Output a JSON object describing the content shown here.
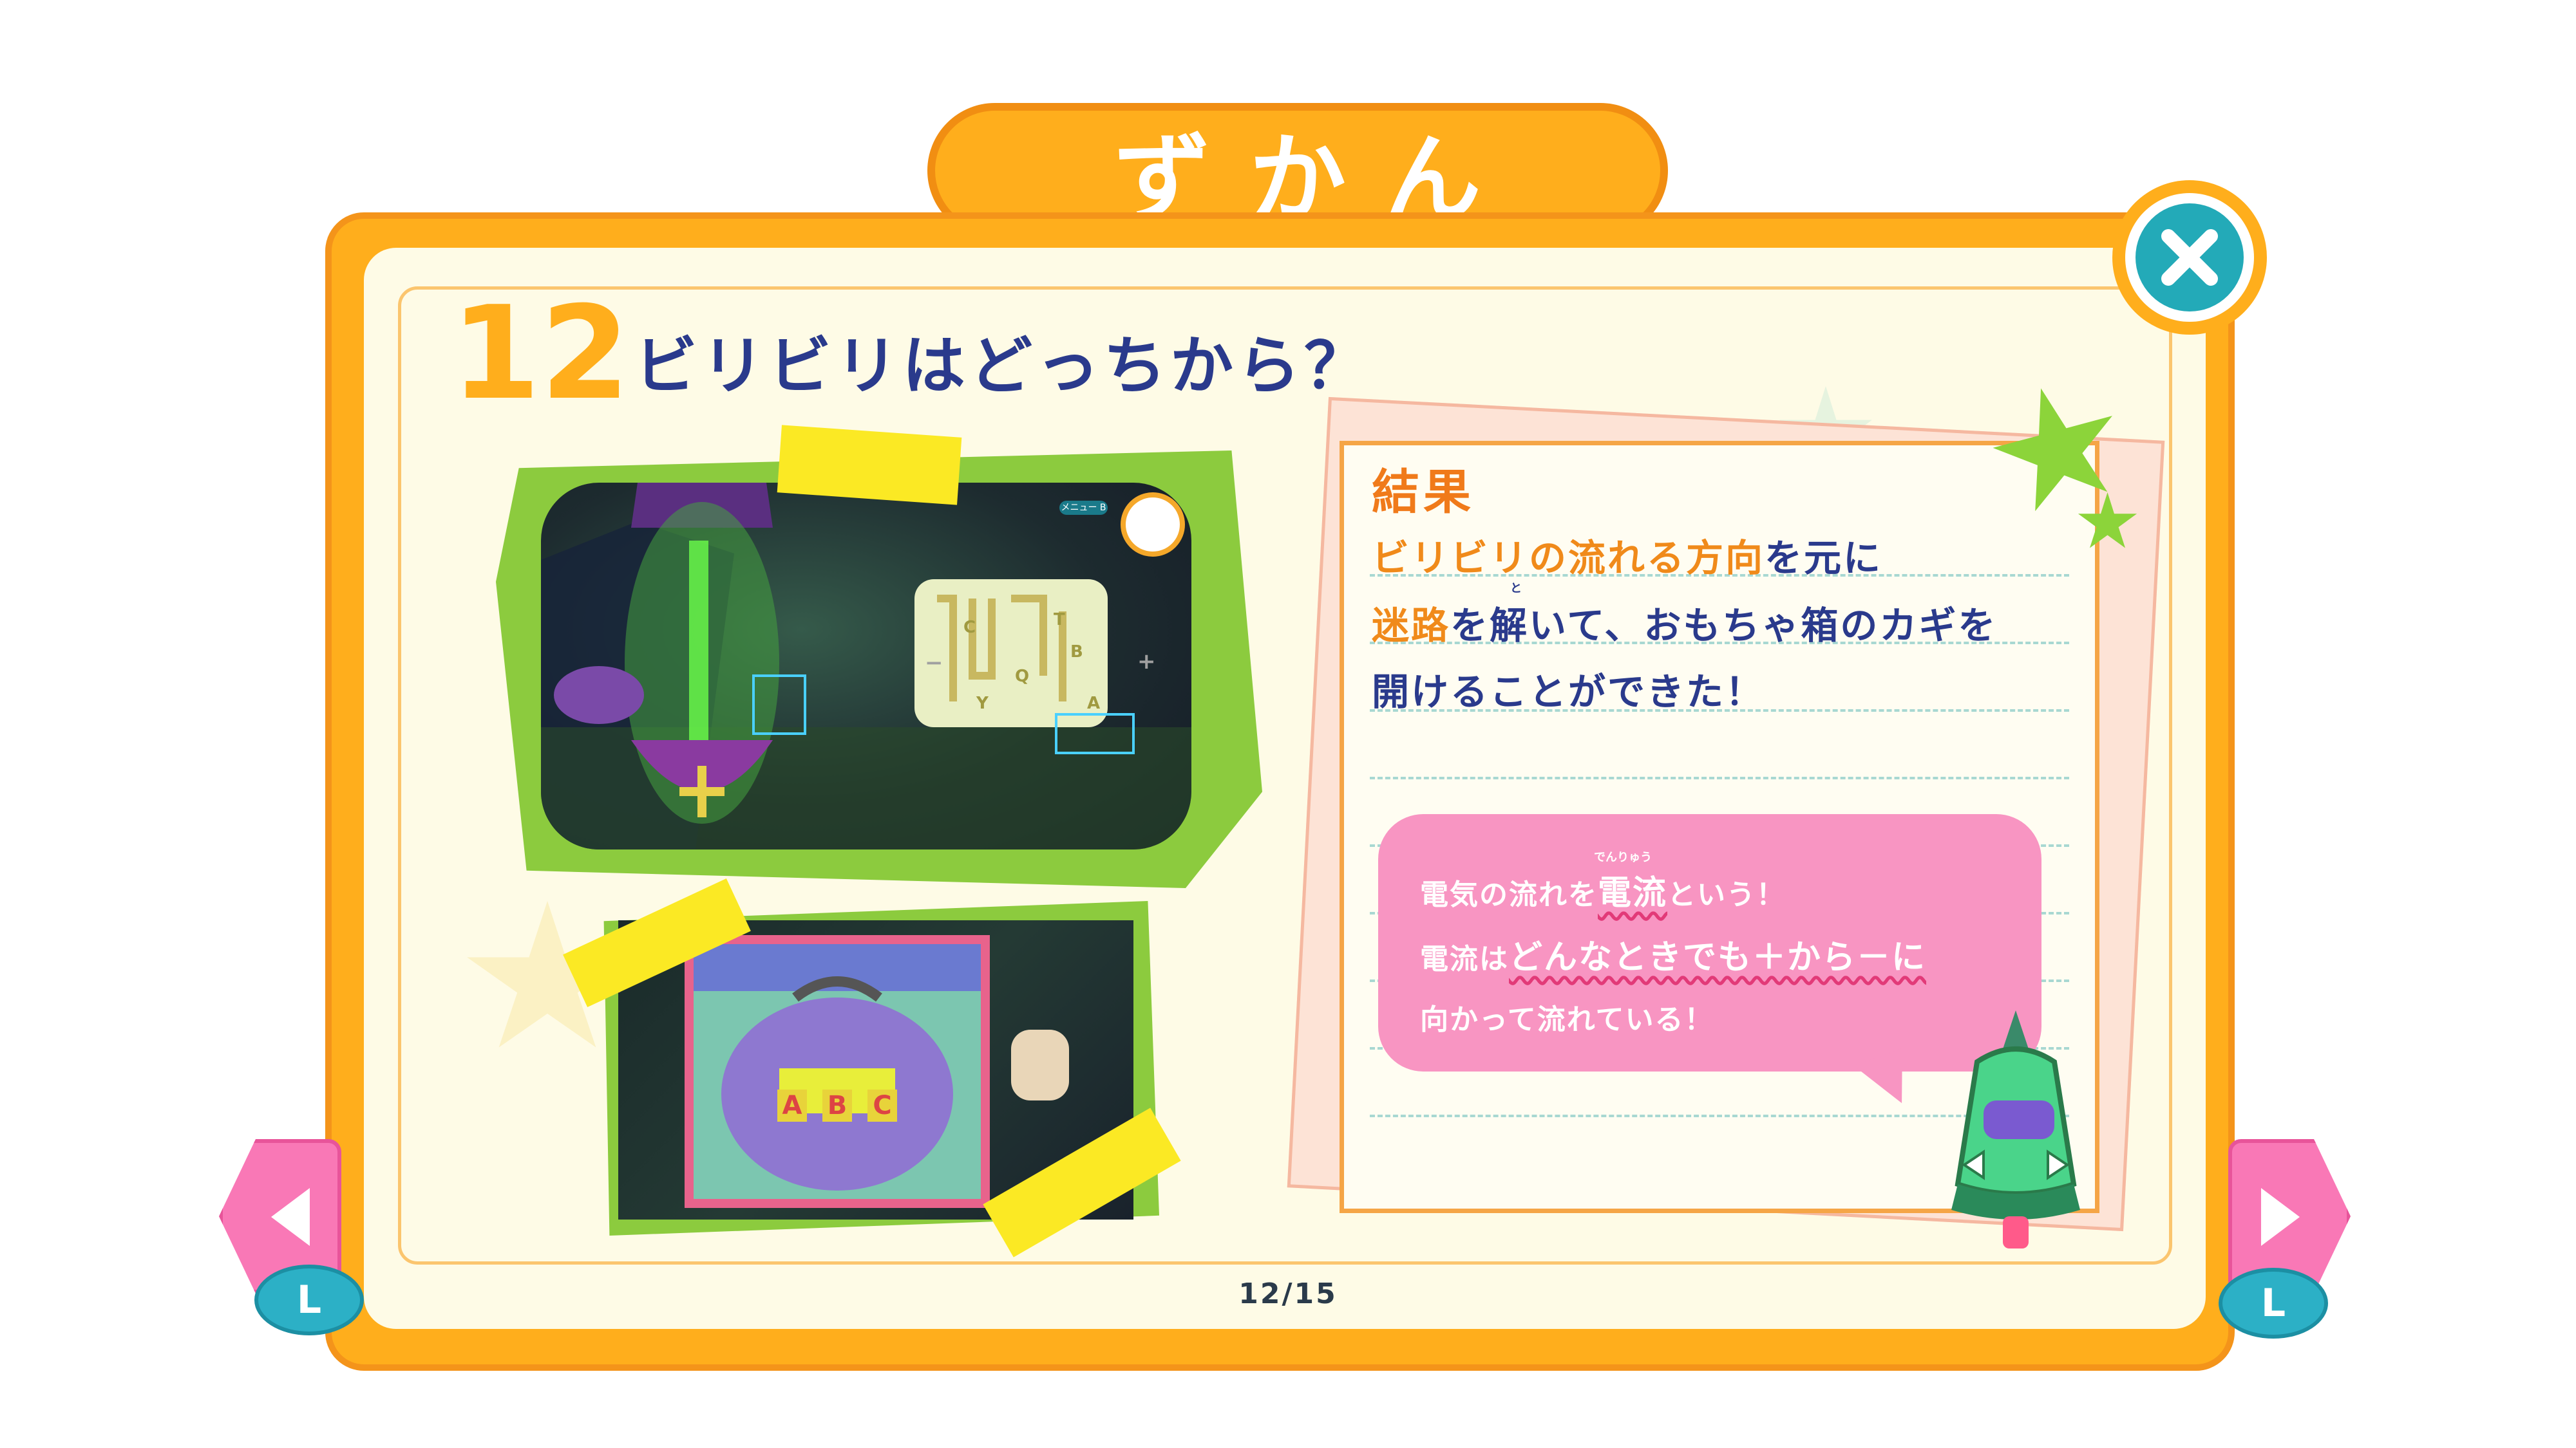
{
  "header": {
    "title": "ずかん"
  },
  "entry": {
    "number": "12",
    "title": "ビリビリはどっちから？"
  },
  "result": {
    "heading": "結果",
    "line1_part1": "ビリビリの流れる方向",
    "line1_part2": "を元に",
    "line2_part1": "迷路",
    "line2_part2": "を解いて、おもちゃ箱のカギを",
    "line2_ruby": "と",
    "line3": "開けることができた！"
  },
  "bubble": {
    "line1_part1": "電気の流れを",
    "line1_part2": "電流",
    "line1_part3": "という！",
    "line1_ruby": "でんりゅう",
    "line2_part1": "電流は",
    "line2_part2": "どんなときでも＋から－に",
    "line3": "向かって流れている！"
  },
  "screenshot1": {
    "menu_label": "メニュー",
    "menu_badge": "B",
    "maze_letters": [
      "C",
      "T",
      "B",
      "Q",
      "Y",
      "A"
    ],
    "plus": "+",
    "minus": "−"
  },
  "screenshot2": {
    "lock_letters": [
      "A",
      "B",
      "C"
    ]
  },
  "navigation": {
    "prev_icon": "triangle-left-icon",
    "next_icon": "triangle-right-icon",
    "prev_button_label": "L",
    "next_button_label": "L",
    "page_counter": "12/15"
  },
  "colors": {
    "frame_orange": "#ffae1c",
    "title_blue": "#2a3a8c",
    "highlight_orange": "#f08a1a",
    "bubble_pink": "#f895c2",
    "close_teal": "#23aab8",
    "nav_pink": "#f978b6",
    "tape_yellow": "#fbe924",
    "photo_green": "#8ccb3e"
  }
}
